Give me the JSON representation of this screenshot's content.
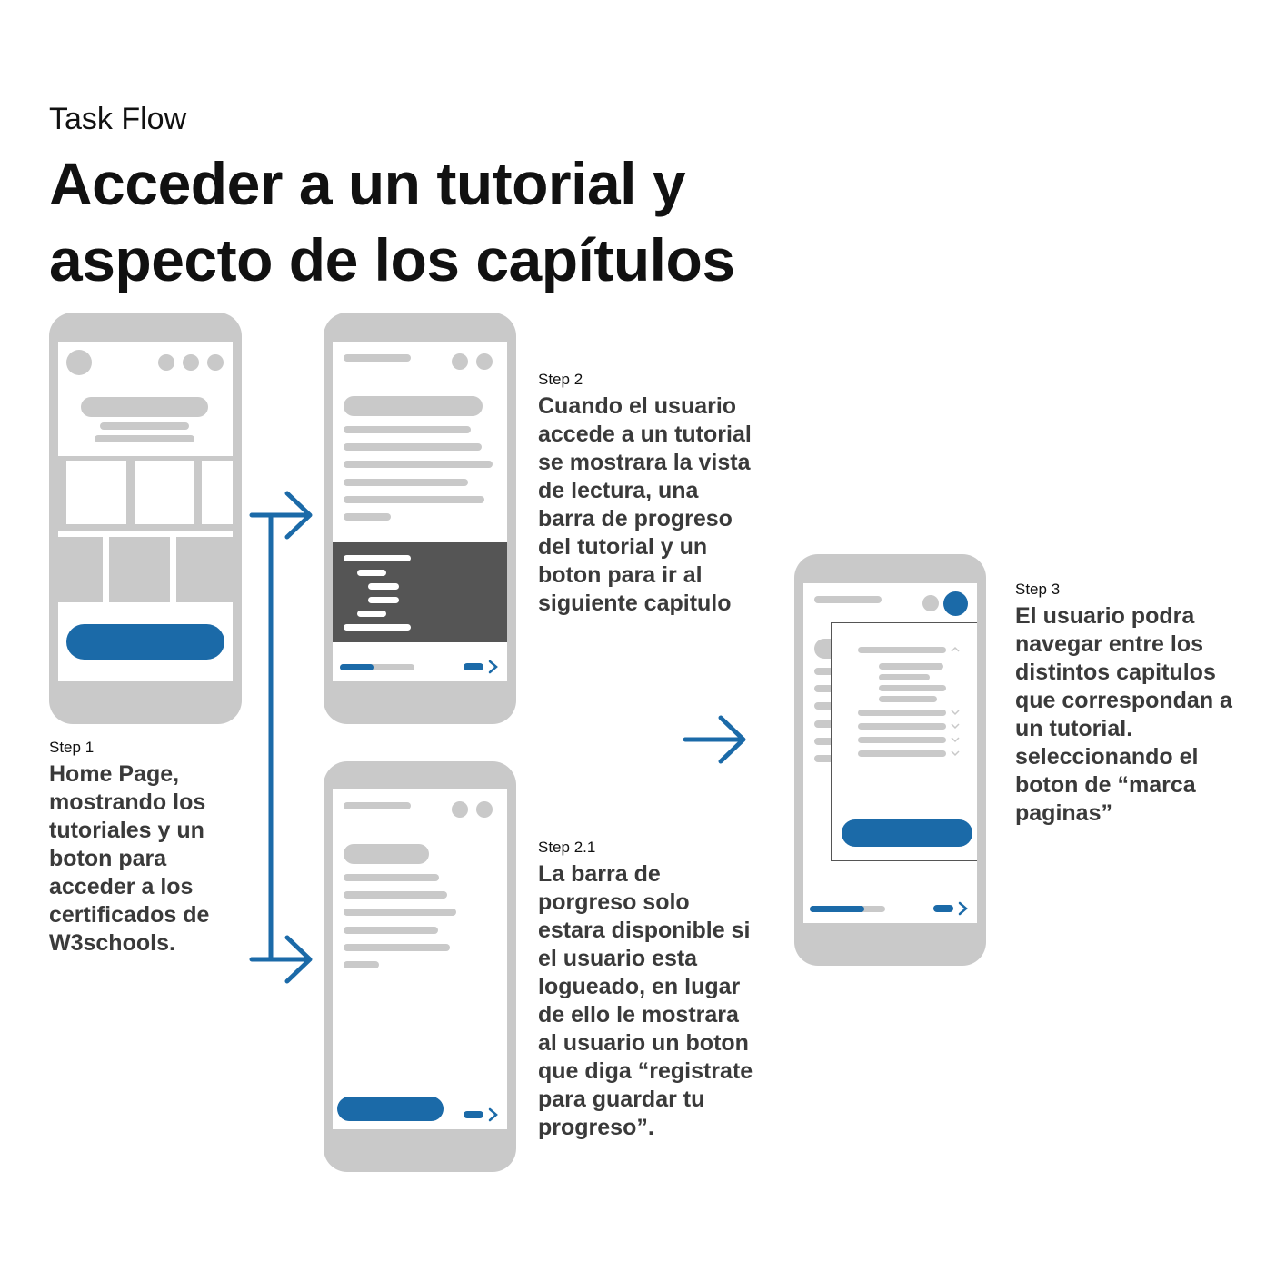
{
  "header": {
    "eyebrow": "Task Flow",
    "title": "Acceder a un tutorial y aspecto de los capítulos"
  },
  "steps": [
    {
      "label": "Step 1",
      "text": "Home Page, mostrando los tutoriales y un boton para acceder a los certificados de W3schools."
    },
    {
      "label": "Step 2",
      "text": "Cuando el usuario accede a un tutorial se mostrara la vista de lectura, una barra de progreso del tutorial y un boton para ir al siguiente capitulo"
    },
    {
      "label": "Step 2.1",
      "text": "La barra de porgreso solo estara disponible si el usuario esta logueado, en lugar de ello le mostrara al usuario un boton que diga “registrate para guardar tu progreso”."
    },
    {
      "label": "Step 3",
      "text": "El usuario podra navegar entre los distintos capitulos que correspondan a un tutorial. seleccionando el boton de “marca paginas”"
    }
  ],
  "progress": {
    "step2": 0.45,
    "step3": 0.72
  },
  "colors": {
    "accent": "#1b6aa8",
    "placeholder": "#c9c9c9",
    "code_block": "#555555",
    "text": "#3a3a3a"
  },
  "icons": [
    "arrow-right-icon",
    "chevron-right-icon",
    "chevron-up-icon",
    "chevron-down-icon"
  ]
}
